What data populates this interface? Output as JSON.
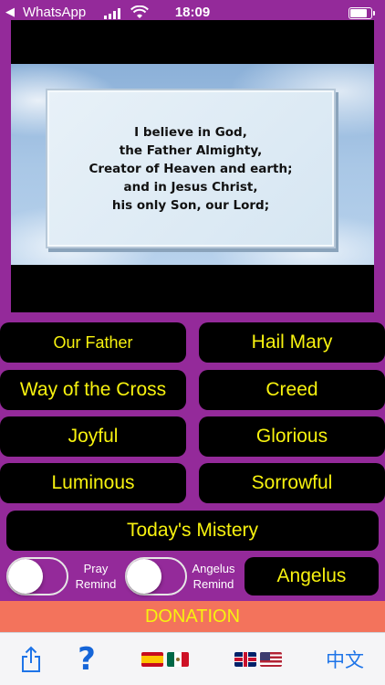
{
  "status_bar": {
    "back_arrow": "◀",
    "back_app": "WhatsApp",
    "time": "18:09",
    "battery_level": 0.85
  },
  "prayer_display": {
    "lines": [
      "I believe in God,",
      "the Father Almighty,",
      "Creator of Heaven and earth;",
      "and in Jesus Christ,",
      "his only Son, our Lord;"
    ]
  },
  "buttons": {
    "our_father": "Our Father",
    "hail_mary": "Hail Mary",
    "way_of_the_cross": "Way of the Cross",
    "creed": "Creed",
    "joyful": "Joyful",
    "glorious": "Glorious",
    "luminous": "Luminous",
    "sorrowful": "Sorrowful",
    "todays_mystery": "Today's Mistery",
    "angelus": "Angelus"
  },
  "toggles": {
    "pray_remind": {
      "label_line1": "Pray",
      "label_line2": "Remind",
      "on": false
    },
    "angelus_remind": {
      "label_line1": "Angelus",
      "label_line2": "Remind",
      "on": false
    }
  },
  "donation": {
    "label": "DONATION"
  },
  "toolbar": {
    "share_icon": "share-icon",
    "help_label": "?",
    "spanish_flags": [
      "spain-flag",
      "mexico-flag"
    ],
    "english_flags": [
      "uk-flag",
      "us-flag"
    ],
    "chinese_label": "中文"
  },
  "colors": {
    "background": "#942a9a",
    "button_bg": "#000000",
    "button_text": "#f7f20f",
    "donation_bg": "#f3735c",
    "toolbar_bg": "#f5f5f7",
    "link_blue": "#1e74e8"
  }
}
